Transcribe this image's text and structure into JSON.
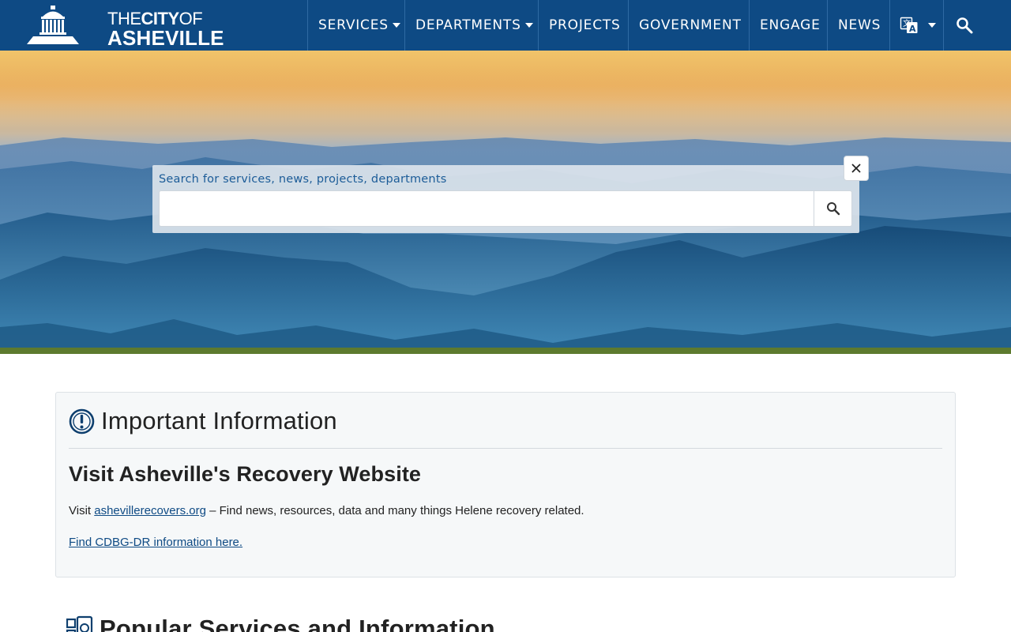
{
  "header": {
    "logo": {
      "line1_prefix": "THE",
      "line1_bold": "CITY",
      "line1_suffix": "OF",
      "line2": "ASHEVILLE"
    },
    "nav": [
      {
        "label": "SERVICES",
        "has_dropdown": true
      },
      {
        "label": "DEPARTMENTS",
        "has_dropdown": true
      },
      {
        "label": "PROJECTS",
        "has_dropdown": false
      },
      {
        "label": "GOVERNMENT",
        "has_dropdown": false
      },
      {
        "label": "ENGAGE",
        "has_dropdown": false
      },
      {
        "label": "NEWS",
        "has_dropdown": false
      }
    ],
    "translate_icon": "translate-icon",
    "search_icon": "search-icon"
  },
  "hero": {
    "search_label": "Search for services, news, projects, departments",
    "search_value": "",
    "search_button_icon": "search-icon",
    "close_icon": "close-icon"
  },
  "important": {
    "icon": "exclamation-circle-icon",
    "title": "Important Information",
    "subtitle": "Visit Asheville's Recovery Website",
    "para_prefix": "Visit ",
    "para_link": "ashevillerecovers.org",
    "para_suffix": " – Find news, resources, data and many things Helene recovery related.",
    "cdbg_link": "Find CDBG-DR information here."
  },
  "popular": {
    "icon": "services-grid-icon",
    "title": "Popular Services and Information"
  },
  "colors": {
    "nav_bg": "#0e4a84",
    "accent_stripe": "#5d7a2e",
    "link": "#0e4a84"
  }
}
